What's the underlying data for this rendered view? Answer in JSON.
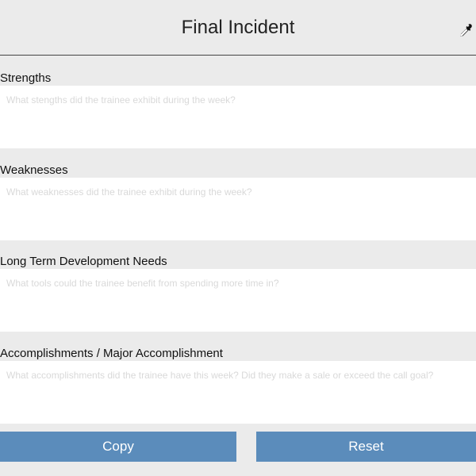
{
  "header": {
    "title": "Final Incident",
    "tool_icon": "eyedropper-icon"
  },
  "sections": [
    {
      "label": "Strengths",
      "placeholder": "What stengths did the trainee exhibit during the week?",
      "value": ""
    },
    {
      "label": "Weaknesses",
      "placeholder": "What weaknesses did the trainee exhibit during the week?",
      "value": ""
    },
    {
      "label": "Long Term Development Needs",
      "placeholder": "What tools could the trainee benefit from spending more time in?",
      "value": ""
    },
    {
      "label": "Accomplishments / Major Accomplishment",
      "placeholder": "What accomplishments did the trainee have this week? Did they make a sale or exceed the call goal?",
      "value": ""
    }
  ],
  "buttons": {
    "copy_label": "Copy",
    "reset_label": "Reset"
  },
  "colors": {
    "background": "#ebebeb",
    "field_background": "#ffffff",
    "button": "#5b8cbb",
    "placeholder": "#d9d9d9"
  }
}
